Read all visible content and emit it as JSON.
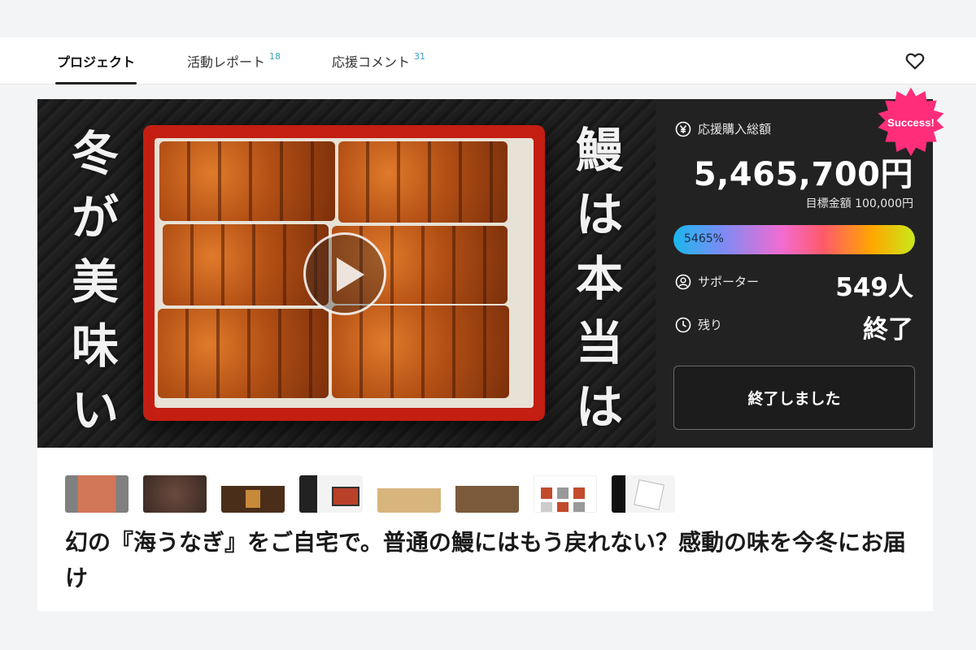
{
  "tabs": [
    {
      "label": "プロジェクト",
      "count": ""
    },
    {
      "label": "活動レポート",
      "count": "18"
    },
    {
      "label": "応援コメント",
      "count": "31"
    }
  ],
  "hero": {
    "left_text": [
      "冬",
      "が",
      "美",
      "味",
      "い"
    ],
    "right_text": [
      "鰻",
      "は",
      "本",
      "当",
      "は"
    ]
  },
  "panel": {
    "badge": "Success!",
    "total_label": "応援購入総額",
    "total_value": "5,465,700円",
    "goal_text": "目標金額 100,000円",
    "progress_text": "5465%",
    "progress_fraction": 1.0,
    "supporters_label": "サポーター",
    "supporters_value": "549人",
    "remaining_label": "残り",
    "remaining_value": "終了",
    "ended_button": "終了しました"
  },
  "project_title": "幻の『海うなぎ』をご自宅で。普通の鰻にはもう戻れない？感動の味を今冬にお届け",
  "colors": {
    "panel_bg": "#222222",
    "badge": "#ff2d7a",
    "count_accent": "#3aa3c9"
  }
}
